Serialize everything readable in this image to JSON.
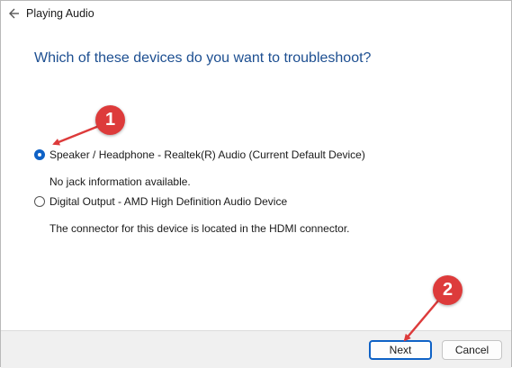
{
  "window": {
    "title": "Playing Audio"
  },
  "heading": "Which of these devices do you want to troubleshoot?",
  "options": [
    {
      "label": "Speaker / Headphone - Realtek(R) Audio (Current Default Device)",
      "description": "No jack information available.",
      "selected": true
    },
    {
      "label": "Digital Output - AMD High Definition Audio Device",
      "description": "The connector for this device is located in the HDMI connector.",
      "selected": false
    }
  ],
  "buttons": {
    "next": "Next",
    "cancel": "Cancel"
  },
  "annotations": {
    "step1": "1",
    "step2": "2",
    "color": "#dd3b3b"
  },
  "colors": {
    "heading": "#1d4f91",
    "accent": "#0f62c6"
  },
  "icons": {
    "back": "back-arrow-icon"
  }
}
